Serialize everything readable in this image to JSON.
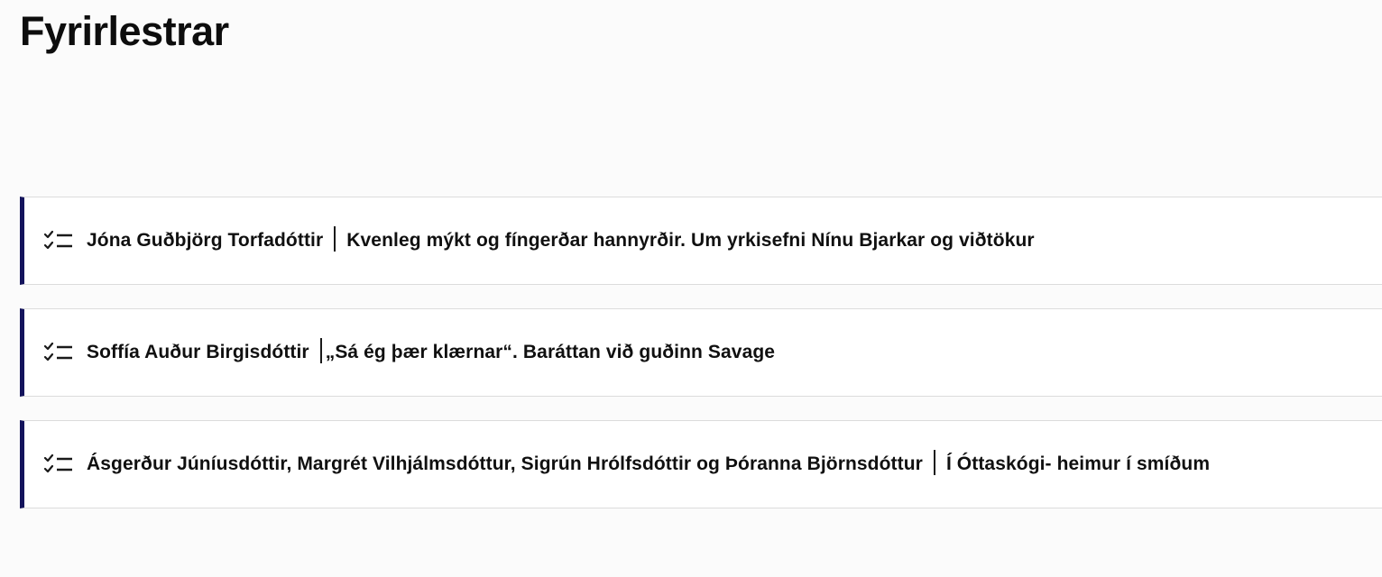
{
  "page": {
    "title": "Fyrirlestrar"
  },
  "lectures": [
    {
      "speaker": "Jóna Guðbjörg Torfadóttir",
      "title": "Kvenleg mýkt og fíngerðar hannyrðir. Um yrkisefni Nínu Bjarkar og viðtökur"
    },
    {
      "speaker": "Soffía Auður Birgisdóttir",
      "title": "„Sá ég þær klærnar“. Baráttan við guðinn Savage"
    },
    {
      "speaker": "Ásgerður Júníusdóttir, Margrét Vilhjálmsdóttur, Sigrún Hrólfsdóttir og Þóranna Björnsdóttur",
      "title": "Í Óttaskógi- heimur í smíðum"
    }
  ],
  "icons": {
    "lecture_icon": "checklist-icon"
  },
  "colors": {
    "accent_border": "#14145c",
    "background": "#fbfbfb"
  }
}
